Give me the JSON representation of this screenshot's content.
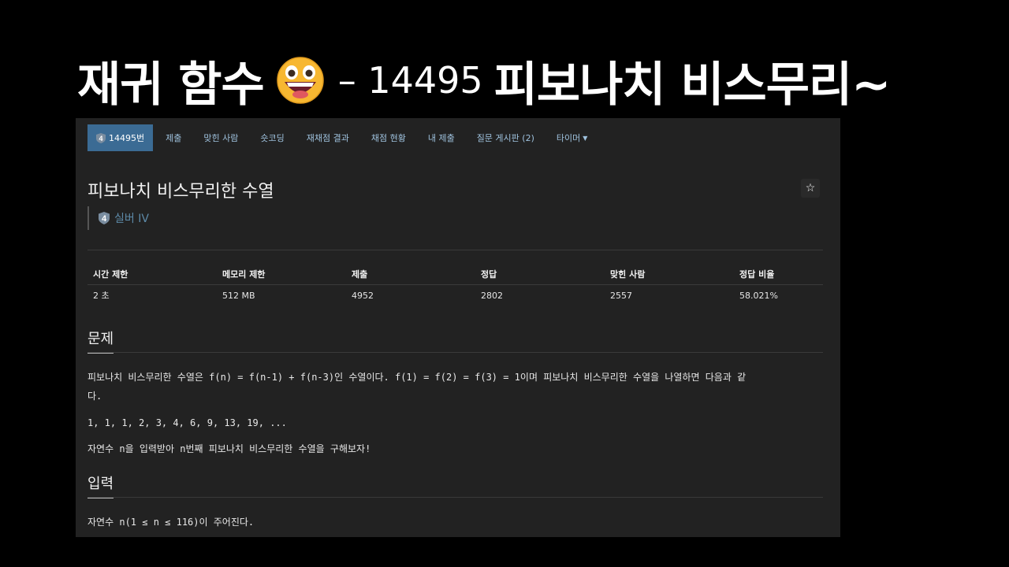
{
  "slide": {
    "title_prefix": "재귀 함수",
    "title_number": "– 14495",
    "title_suffix": "피보나치 비스무리~",
    "emoji": "grinning-face-emoji"
  },
  "nav": {
    "items": [
      {
        "label": "14495번",
        "badge": "4",
        "active": true
      },
      {
        "label": "제출"
      },
      {
        "label": "맞힌 사람"
      },
      {
        "label": "숏코딩"
      },
      {
        "label": "재채점 결과"
      },
      {
        "label": "채점 현황"
      },
      {
        "label": "내 제출"
      },
      {
        "label": "질문 게시판 (2)"
      },
      {
        "label": "타이머",
        "dropdown": true
      }
    ]
  },
  "problem": {
    "title": "피보나치 비스무리한 수열",
    "star": "☆",
    "tier_badge": "4",
    "tier": "실버 IV"
  },
  "stats": {
    "headers": [
      "시간 제한",
      "메모리 제한",
      "제출",
      "정답",
      "맞힌 사람",
      "정답 비율"
    ],
    "values": [
      "2 초",
      "512 MB",
      "4952",
      "2802",
      "2557",
      "58.021%"
    ]
  },
  "sections": {
    "problem_head": "문제",
    "problem_line1": "피보나치 비스무리한 수열은 f(n) = f(n-1) + f(n-3)인 수열이다. f(1) = f(2) = f(3) = 1이며 피보나치 비스무리한 수열을 나열하면 다음과 같",
    "problem_line1_wrap": "다.",
    "problem_seq": "1, 1, 1, 2, 3, 4, 6, 9, 13, 19, ...",
    "problem_line3": "자연수 n을 입력받아 n번째 피보나치 비스무리한 수열을 구해보자!",
    "input_head": "입력",
    "input_line": "자연수 n(1 ≤ n ≤ 116)이 주어진다."
  },
  "colors": {
    "background": "#000000",
    "panel": "#222222",
    "nav_active": "#3b6b94",
    "nav_link": "#9fc2de",
    "tier": "#5d8aa8",
    "emoji_face": "#f7b731"
  }
}
